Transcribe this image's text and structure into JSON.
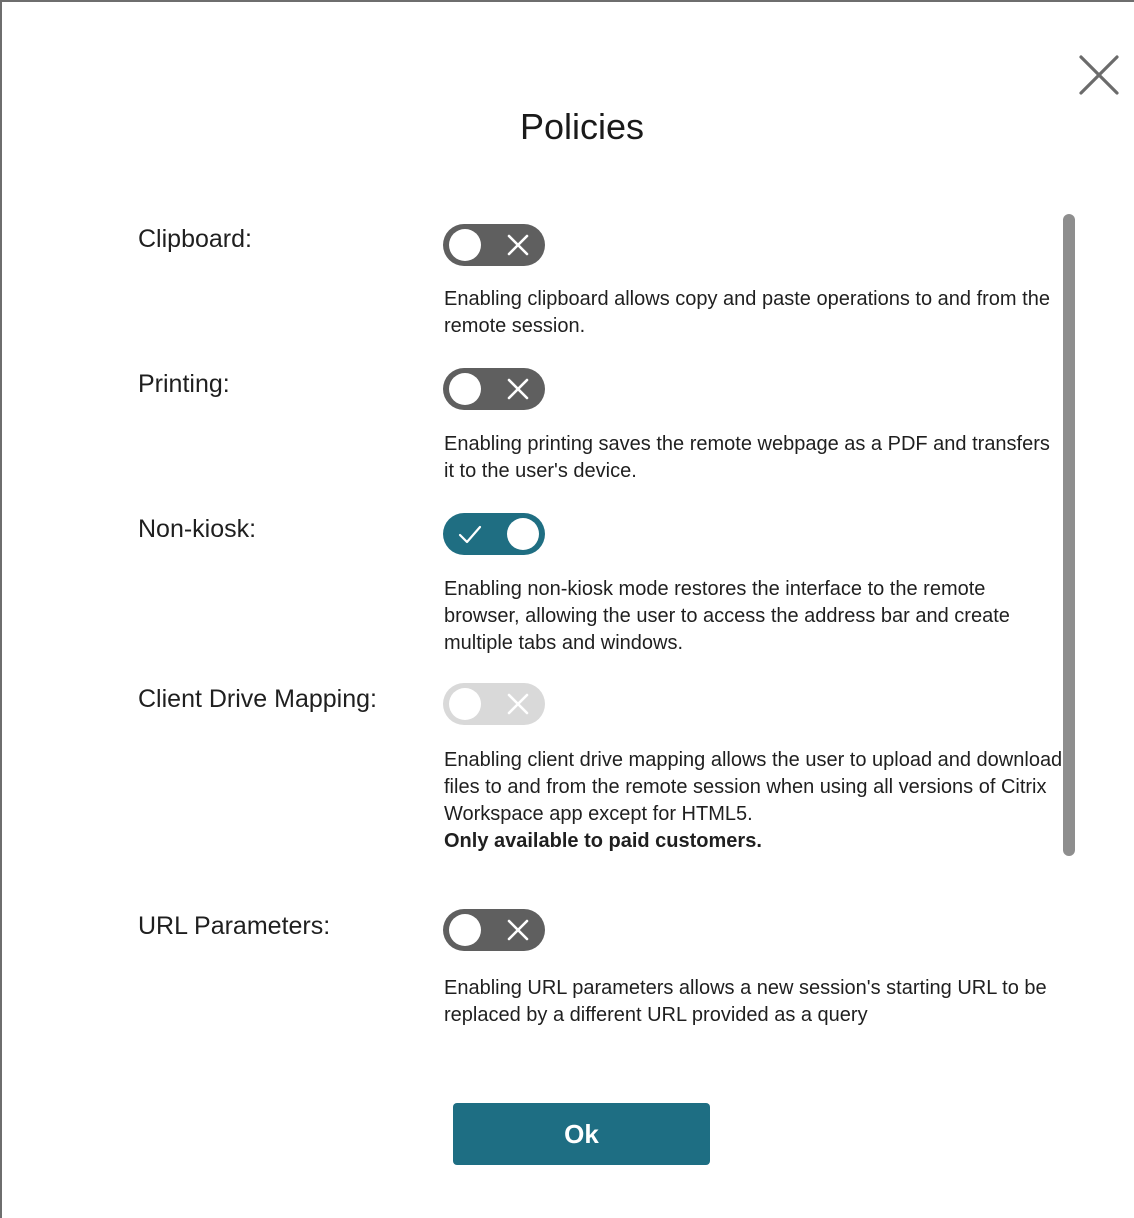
{
  "dialog": {
    "title": "Policies",
    "close_icon": "close-icon",
    "ok_label": "Ok"
  },
  "policies": [
    {
      "label": "Clipboard:",
      "state": "off",
      "description": "Enabling clipboard allows copy and paste operations to and from the remote session."
    },
    {
      "label": "Printing:",
      "state": "off",
      "description": "Enabling printing saves the remote webpage as a PDF and transfers it to the user's device."
    },
    {
      "label": "Non-kiosk:",
      "state": "on",
      "description": "Enabling non-kiosk mode restores the interface to the remote browser, allowing the user to access the address bar and create multiple tabs and windows."
    },
    {
      "label": "Client Drive Mapping:",
      "state": "disabled",
      "description": "Enabling client drive mapping allows the user to upload and download files to and from the remote session when using all versions of Citrix Workspace app except for HTML5.",
      "note": "Only available to paid customers."
    },
    {
      "label": "URL Parameters:",
      "state": "off",
      "description": "Enabling URL parameters allows a new session's starting URL to be replaced by a different URL provided as a query"
    }
  ],
  "colors": {
    "accent": "#1e6e83",
    "toggle_off": "#5f5f5f",
    "toggle_disabled": "#d9d9d9",
    "scrollbar": "#8e8e8e"
  }
}
